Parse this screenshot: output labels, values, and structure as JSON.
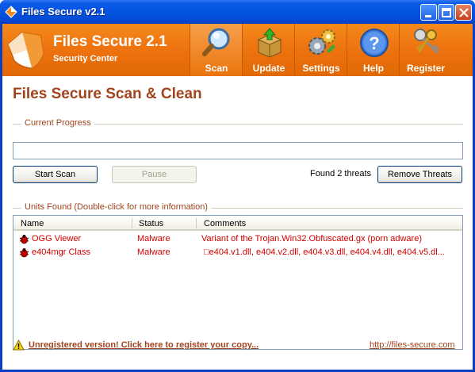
{
  "window": {
    "title": "Files Secure v2.1"
  },
  "header": {
    "app_name": "Files Secure 2.1",
    "app_subtitle": "Security Center",
    "nav": [
      {
        "label": "Scan",
        "icon": "magnifier-icon",
        "active": true
      },
      {
        "label": "Update",
        "icon": "box-update-icon",
        "active": false
      },
      {
        "label": "Settings",
        "icon": "settings-gears-icon",
        "active": false
      },
      {
        "label": "Help",
        "icon": "help-question-icon",
        "active": false
      },
      {
        "label": "Register",
        "icon": "keys-icon",
        "active": false
      }
    ]
  },
  "main": {
    "heading": "Files Secure Scan & Clean",
    "progress_group_label": "Current Progress",
    "buttons": {
      "start_scan": "Start Scan",
      "pause": "Pause",
      "remove_threats": "Remove Threats"
    },
    "threat_status": "Found 2 threats",
    "units_group_label": "Units Found (Double-click for more information)",
    "table": {
      "columns": [
        "Name",
        "Status",
        "Comments"
      ],
      "rows": [
        {
          "name": "OGG Viewer",
          "status": "Malware",
          "comment": "Variant of the Trojan.Win32.Obfuscated.gx (porn adware)"
        },
        {
          "name": "e404mgr Class",
          "status": "Malware",
          "comment": "□e404.v1.dll, e404.v2.dll, e404.v3.dll, e404.v4.dll, e404.v5.dl..."
        }
      ]
    }
  },
  "footer": {
    "register_link": "Unregistered version! Click here to register your copy...",
    "site_link": "http://files-secure.com"
  },
  "colors": {
    "accent_orange": "#ee7410",
    "heading_brown": "#a1431d",
    "threat_red": "#d20000",
    "titlebar_blue": "#0353e0"
  }
}
